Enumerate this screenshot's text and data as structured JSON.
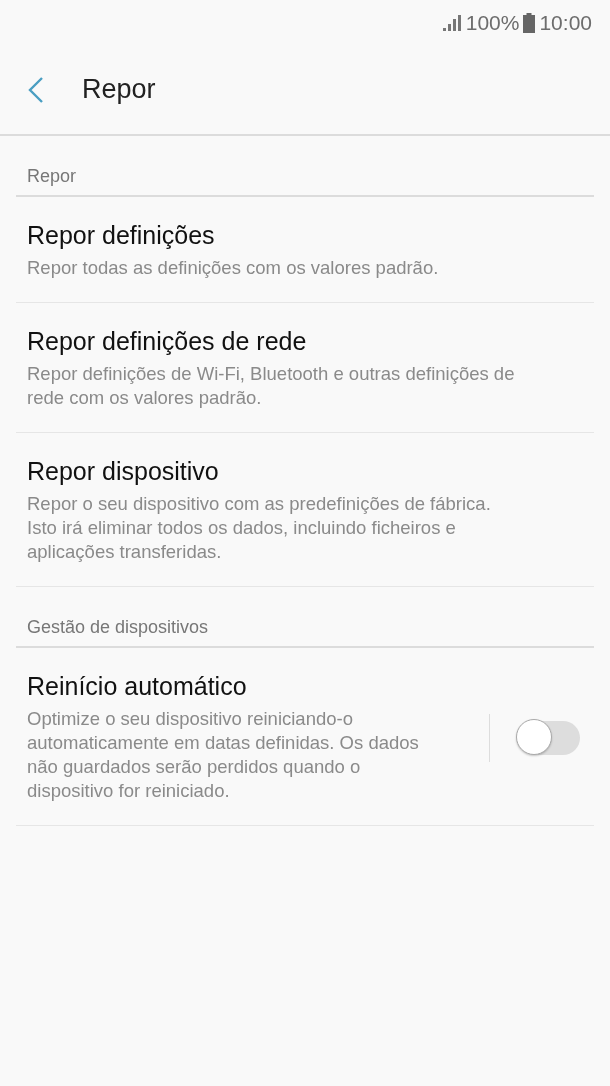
{
  "status_bar": {
    "battery": "100%",
    "time": "10:00"
  },
  "header": {
    "title": "Repor"
  },
  "sections": [
    {
      "title": "Repor",
      "items": [
        {
          "kind": "plain",
          "title": "Repor definições",
          "description": "Repor todas as definições com os valores padrão."
        },
        {
          "kind": "plain",
          "title": "Repor definições de rede",
          "description": "Repor definições de Wi-Fi, Bluetooth e outras definições de rede com os valores padrão."
        },
        {
          "kind": "plain",
          "title": "Repor dispositivo",
          "description": "Repor o seu dispositivo com as predefinições de fábrica. Isto irá eliminar todos os dados, incluindo ficheiros e aplicações transferidas."
        }
      ]
    },
    {
      "title": "Gestão de dispositivos",
      "items": [
        {
          "kind": "switch",
          "title": "Reinício automático",
          "description": "Optimize o seu dispositivo reiniciando-o automaticamente em datas definidas. Os dados não guardados serão perdidos quando o dispositivo for reiniciado.",
          "on": false
        }
      ]
    }
  ]
}
